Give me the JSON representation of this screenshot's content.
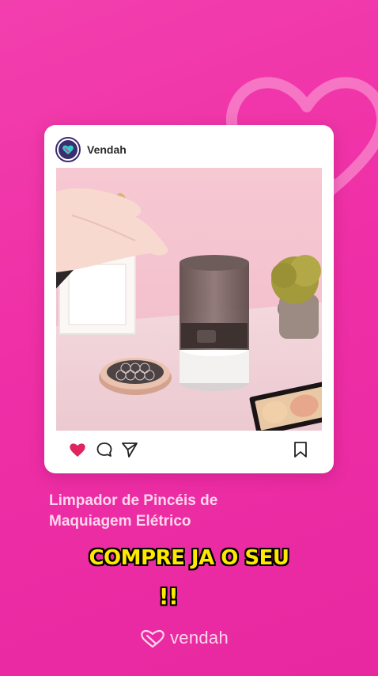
{
  "post": {
    "account_name": "Vendah"
  },
  "caption": {
    "text": "Limpador de Pincéis de\nMaquiagem Elétrico"
  },
  "cta": {
    "line1": "COMPRE JA O SEU",
    "line2": "!!"
  },
  "footer": {
    "brand": "vendah"
  },
  "icons": {
    "like": "heart-icon",
    "comment": "comment-icon",
    "share": "send-icon",
    "save": "bookmark-icon",
    "avatar": "vendah-logo-icon",
    "brand": "vendah-heart-logo-icon"
  },
  "colors": {
    "background": "#ef2fa6",
    "like": "#e0245e",
    "caption": "#ffd6ec",
    "cta": "#ffe800"
  }
}
